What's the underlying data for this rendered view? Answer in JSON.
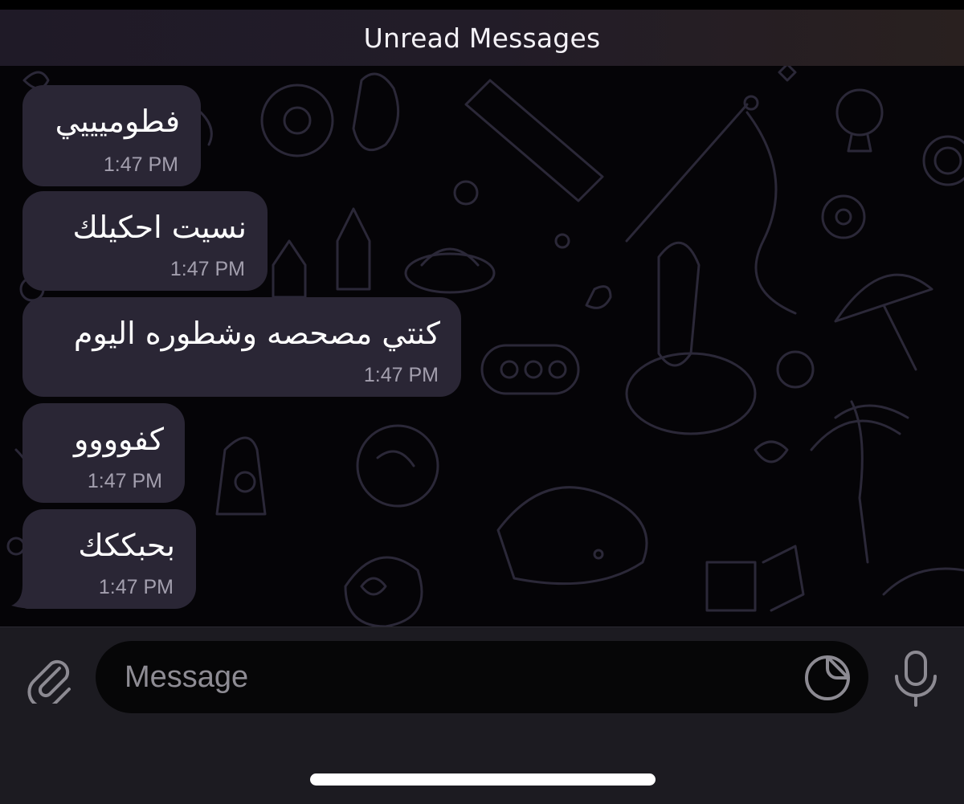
{
  "banner": {
    "label": "Unread Messages"
  },
  "messages": [
    {
      "text": "فطوميييي",
      "time": "1:47 PM"
    },
    {
      "text": "نسيت احكيلك",
      "time": "1:47 PM"
    },
    {
      "text": "كنتي مصحصه وشطوره اليوم",
      "time": "1:47 PM"
    },
    {
      "text": "كفوووو",
      "time": "1:47 PM"
    },
    {
      "text": "بحبككك",
      "time": "1:47 PM"
    }
  ],
  "composer": {
    "placeholder": "Message"
  },
  "icons": {
    "attach": "paperclip-icon",
    "sticker": "sticker-icon",
    "mic": "microphone-icon"
  },
  "colors": {
    "bubble": "#2a2635",
    "background": "#050407",
    "doodle": "#2b2838",
    "composer_bar": "#1c1b21"
  }
}
